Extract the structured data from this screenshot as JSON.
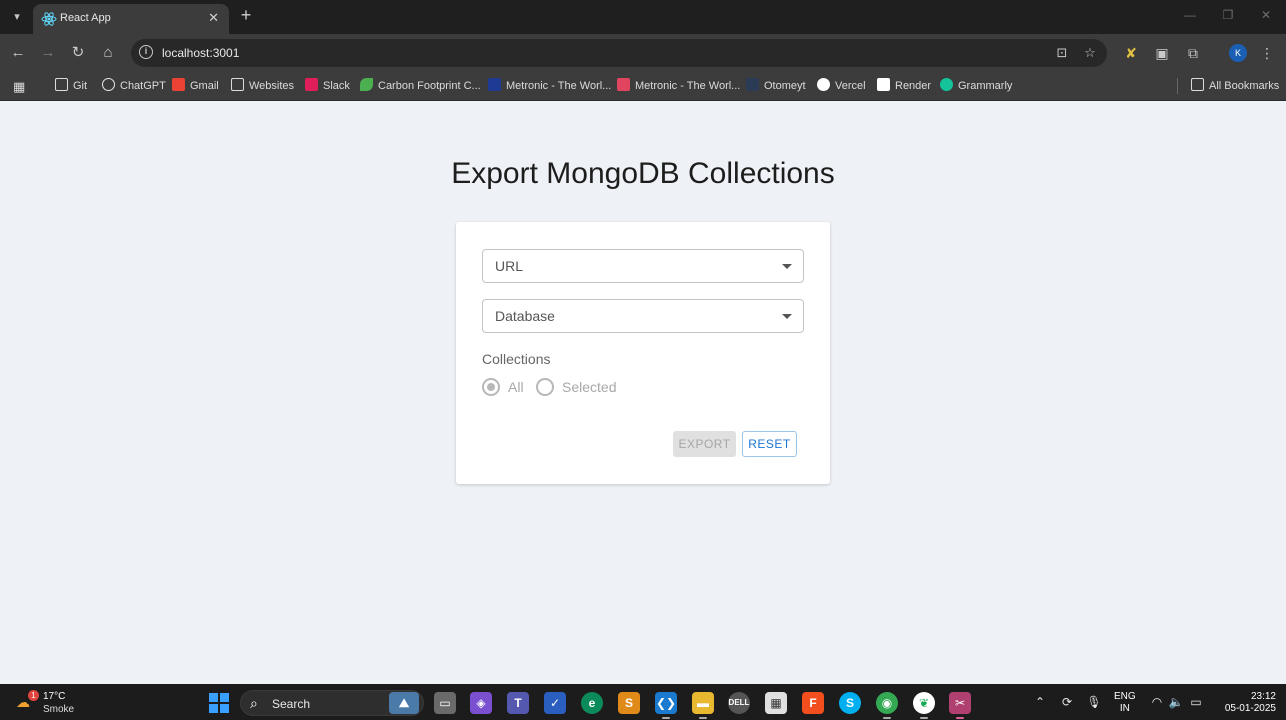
{
  "browser": {
    "tab_title": "React App",
    "url": "localhost:3001",
    "profile_initial": "K",
    "bookmarks": [
      {
        "label": "Git",
        "icon": "folder-icon",
        "color": "#dcdcdc"
      },
      {
        "label": "ChatGPT",
        "icon": "chatgpt-icon",
        "color": "#e8e8e8"
      },
      {
        "label": "Gmail",
        "icon": "gmail-icon",
        "color": "#ea4335"
      },
      {
        "label": "Websites",
        "icon": "folder-icon",
        "color": "#dcdcdc"
      },
      {
        "label": "Slack",
        "icon": "slack-icon",
        "color": "#e01e5a"
      },
      {
        "label": "Carbon Footprint C...",
        "icon": "leaf-icon",
        "color": "#4caf50"
      },
      {
        "label": "Metronic - The Worl...",
        "icon": "metronic-icon",
        "color": "#1f3a93"
      },
      {
        "label": "Metronic - The Worl...",
        "icon": "metronic-icon",
        "color": "#e0445e"
      },
      {
        "label": "Otomeyt",
        "icon": "otomeyt-icon",
        "color": "#2b3a55"
      },
      {
        "label": "Vercel",
        "icon": "vercel-icon",
        "color": "#ffffff"
      },
      {
        "label": "Render",
        "icon": "render-icon",
        "color": "#ffffff"
      },
      {
        "label": "Grammarly",
        "icon": "grammarly-icon",
        "color": "#15c39a"
      }
    ],
    "all_bookmarks_label": "All Bookmarks"
  },
  "page": {
    "heading": "Export MongoDB Collections",
    "url_select_label": "URL",
    "database_select_label": "Database",
    "collections_label": "Collections",
    "radio_all": "All",
    "radio_selected": "Selected",
    "radio_value": "All",
    "export_button": "EXPORT",
    "reset_button": "RESET"
  },
  "taskbar": {
    "weather_temp": "17°C",
    "weather_condition": "Smoke",
    "weather_badge": "1",
    "search_label": "Search",
    "lang_line1": "ENG",
    "lang_line2": "IN",
    "time": "23:12",
    "date": "05-01-2025"
  },
  "colors": {
    "accent": "#1976d2",
    "page_background": "#eef1f5",
    "chrome_dark": "#3c3c3c"
  }
}
